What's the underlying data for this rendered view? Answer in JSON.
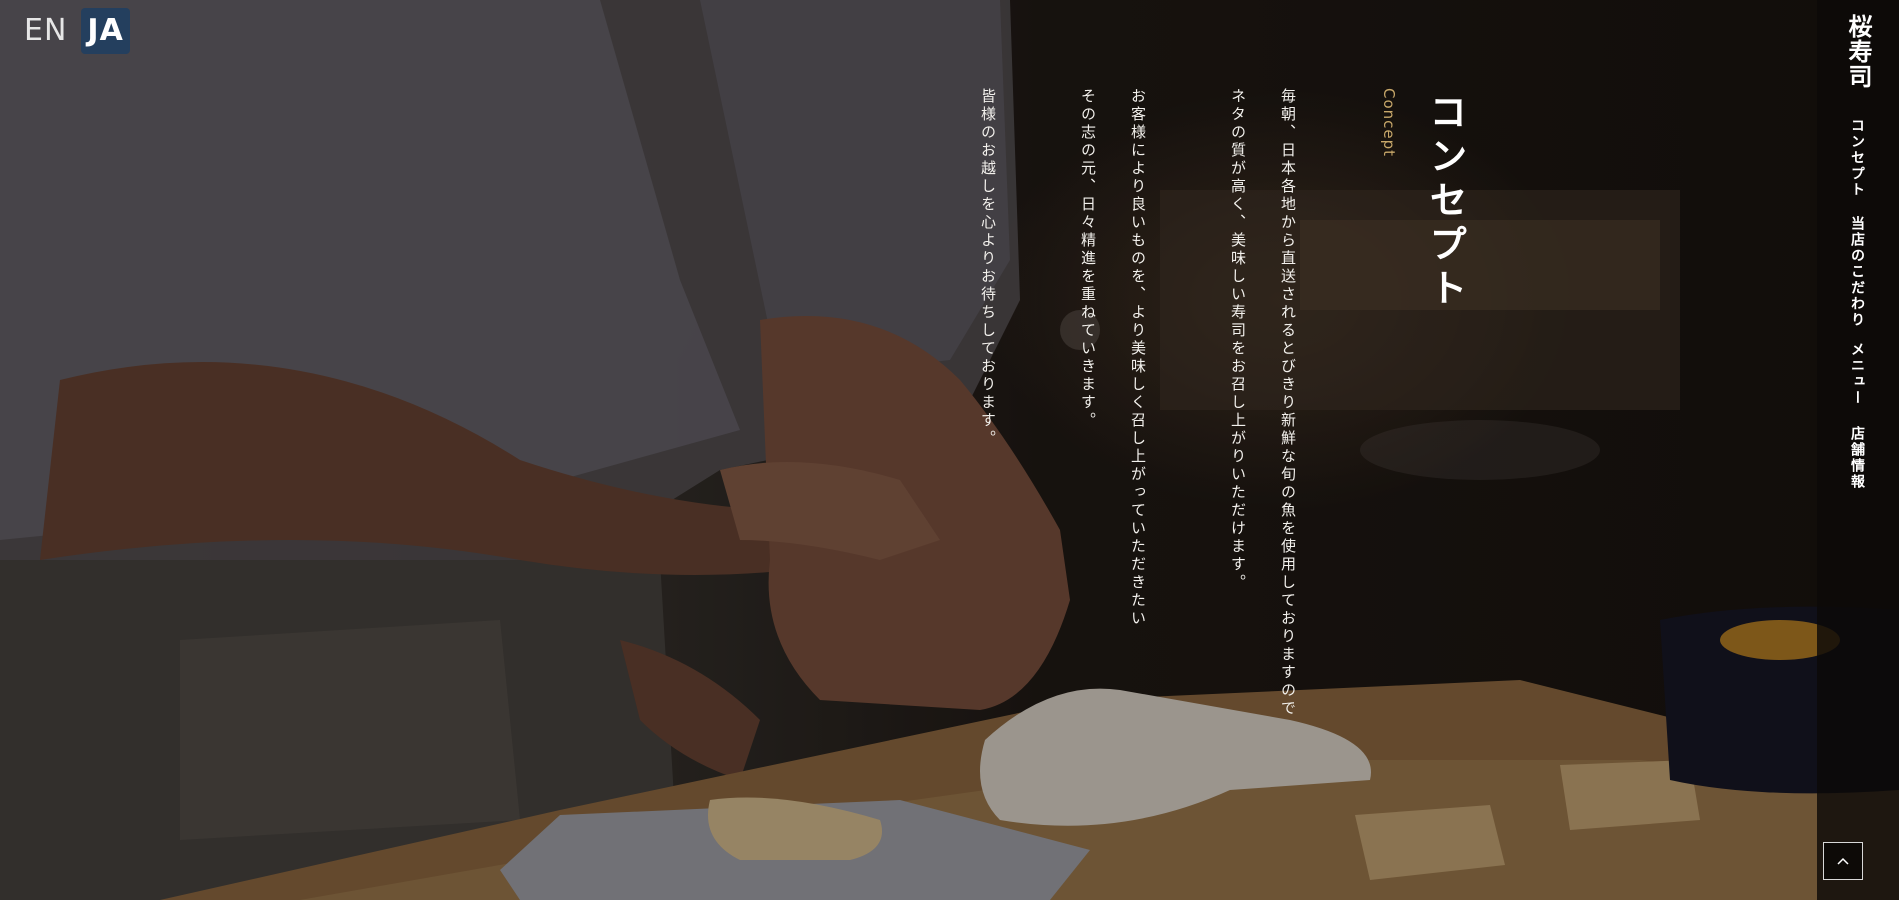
{
  "language_switch": {
    "en_label": "EN",
    "ja_label": "JA",
    "active": "JA"
  },
  "nav": {
    "brand": "桜寿司",
    "items": [
      {
        "label": "コンセプト"
      },
      {
        "label": "当店のこだわり"
      },
      {
        "label": "メニュー"
      },
      {
        "label": "店舗情報"
      }
    ]
  },
  "concept": {
    "title": "コンセプト",
    "subtitle": "Concept",
    "paragraphs": [
      "毎朝、日本各地から直送されるとびきり新鮮な旬の魚を使用しておりますので",
      "ネタの質が高く、美味しい寿司をお召し上がりいただけます。",
      "お客様により良いものを、より美味しく召し上がっていただきたい",
      "その志の元、日々精進を重ねていきます。",
      "皆様のお越しを心よりお待ちしております。"
    ]
  },
  "colors": {
    "accent_gold": "#c8a86a",
    "lang_active_bg": "#243f5e",
    "text": "#f2f0ec"
  },
  "icons": {
    "back_to_top": "chevron-up-icon"
  }
}
